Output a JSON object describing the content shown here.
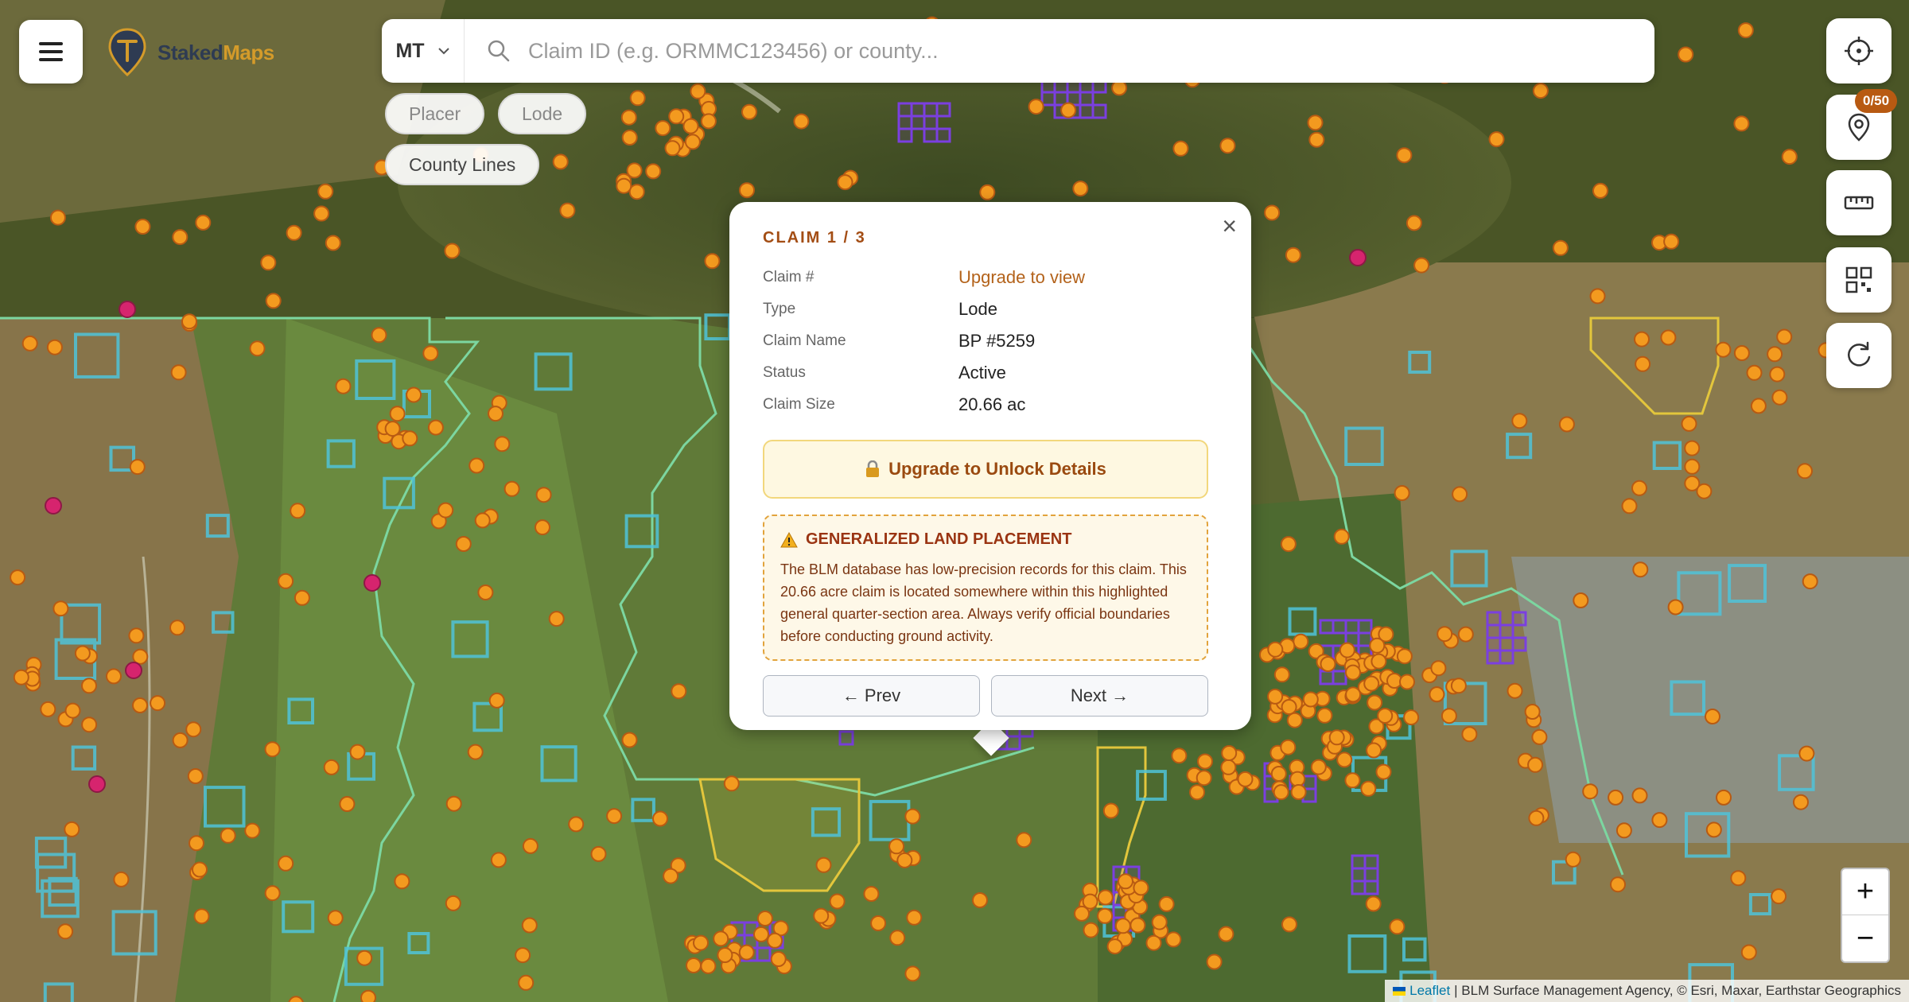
{
  "app": {
    "name_part1": "Staked",
    "name_part2": "Maps"
  },
  "search": {
    "state": "MT",
    "placeholder": "Claim ID (e.g. ORMMC123456) or county..."
  },
  "filters": [
    {
      "label": "Placer"
    },
    {
      "label": "Lode"
    },
    {
      "label": "County Lines"
    }
  ],
  "tools": {
    "pin_badge": "0/50"
  },
  "popup": {
    "title": "CLAIM 1 / 3",
    "fields": [
      {
        "key": "Claim #",
        "value": "Upgrade to view"
      },
      {
        "key": "Type",
        "value": "Lode"
      },
      {
        "key": "Claim Name",
        "value": "BP #5259"
      },
      {
        "key": "Status",
        "value": "Active"
      },
      {
        "key": "Claim Size",
        "value": "20.66 ac"
      }
    ],
    "unlock_label": "Upgrade to Unlock Details",
    "warning_title": "GENERALIZED LAND PLACEMENT",
    "warning_text": "The BLM database has low-precision records for this claim. This 20.66 acre claim is located somewhere within this highlighted general quarter-section area. Always verify official boundaries before conducting ground activity.",
    "prev_label": "← Prev",
    "next_label": "Next →"
  },
  "zoom": {
    "in": "+",
    "out": "−"
  },
  "attribution": {
    "link": "Leaflet",
    "text": "| BLM Surface Management Agency, © Esri, Maxar, Earthstar Geographics"
  },
  "colors": {
    "lode": "#7b3fe0",
    "placer": "#f39a1f",
    "accent": "#a34d14",
    "blm_outline": "#4fc3d9",
    "forest_outline": "#7cd6a0",
    "state_outline": "#e3c63c"
  }
}
